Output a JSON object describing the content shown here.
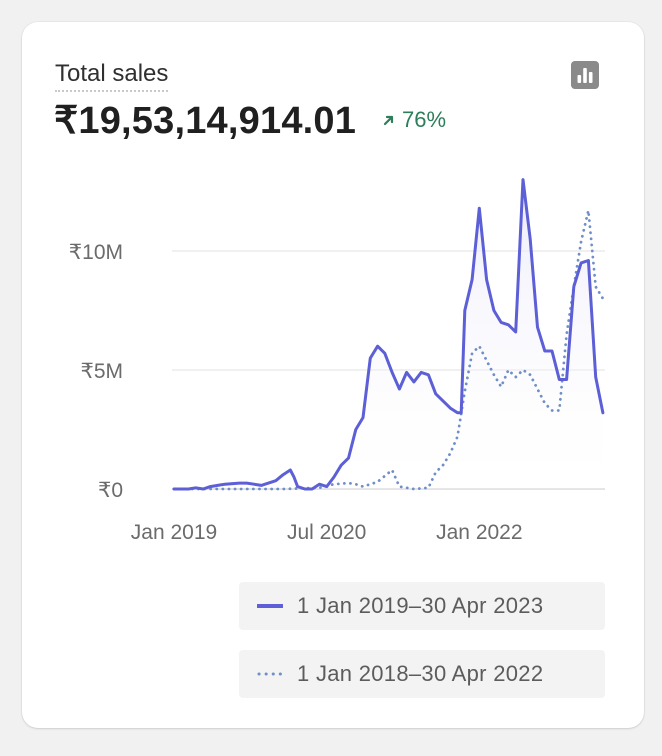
{
  "card": {
    "title": "Total sales",
    "total": "₹19,53,14,914.01",
    "change": "76%",
    "change_color": "#2e7d5b",
    "icon": "bar-chart-icon"
  },
  "chart_data": {
    "type": "line",
    "x_tick_labels": [
      "Jan 2019",
      "Jul 2020",
      "Jan 2022"
    ],
    "y_tick_labels": [
      "₹0",
      "₹5M",
      "₹10M"
    ],
    "ylim": [
      0,
      13000000
    ],
    "grid": true,
    "legend_position": "bottom",
    "series": [
      {
        "name": "1 Jan 2019–30 Apr 2023",
        "style": "solid",
        "color": "#5c5fd6",
        "points": [
          {
            "m": 0,
            "v": 0
          },
          {
            "m": 2,
            "v": 0
          },
          {
            "m": 3,
            "v": 50000
          },
          {
            "m": 4,
            "v": 0
          },
          {
            "m": 5,
            "v": 100000
          },
          {
            "m": 6,
            "v": 150000
          },
          {
            "m": 7,
            "v": 200000
          },
          {
            "m": 9,
            "v": 250000
          },
          {
            "m": 10,
            "v": 250000
          },
          {
            "m": 11,
            "v": 200000
          },
          {
            "m": 12,
            "v": 150000
          },
          {
            "m": 13,
            "v": 250000
          },
          {
            "m": 14,
            "v": 350000
          },
          {
            "m": 15,
            "v": 600000
          },
          {
            "m": 16,
            "v": 800000
          },
          {
            "m": 16.5,
            "v": 500000
          },
          {
            "m": 17,
            "v": 100000
          },
          {
            "m": 18,
            "v": 0
          },
          {
            "m": 19,
            "v": 0
          },
          {
            "m": 20,
            "v": 200000
          },
          {
            "m": 21,
            "v": 100000
          },
          {
            "m": 22,
            "v": 500000
          },
          {
            "m": 23,
            "v": 1000000
          },
          {
            "m": 24,
            "v": 1300000
          },
          {
            "m": 25,
            "v": 2500000
          },
          {
            "m": 26,
            "v": 3000000
          },
          {
            "m": 27,
            "v": 5500000
          },
          {
            "m": 28,
            "v": 6000000
          },
          {
            "m": 29,
            "v": 5700000
          },
          {
            "m": 30,
            "v": 4900000
          },
          {
            "m": 31,
            "v": 4200000
          },
          {
            "m": 32,
            "v": 4900000
          },
          {
            "m": 33,
            "v": 4500000
          },
          {
            "m": 34,
            "v": 4900000
          },
          {
            "m": 35,
            "v": 4800000
          },
          {
            "m": 36,
            "v": 4000000
          },
          {
            "m": 37,
            "v": 3700000
          },
          {
            "m": 38,
            "v": 3400000
          },
          {
            "m": 39,
            "v": 3200000
          },
          {
            "m": 39.5,
            "v": 3200000
          },
          {
            "m": 40,
            "v": 7500000
          },
          {
            "m": 41,
            "v": 8800000
          },
          {
            "m": 42,
            "v": 11800000
          },
          {
            "m": 43,
            "v": 8800000
          },
          {
            "m": 44,
            "v": 7500000
          },
          {
            "m": 45,
            "v": 7000000
          },
          {
            "m": 46,
            "v": 6900000
          },
          {
            "m": 47,
            "v": 6600000
          },
          {
            "m": 48,
            "v": 13000000
          },
          {
            "m": 49,
            "v": 10500000
          },
          {
            "m": 50,
            "v": 6800000
          },
          {
            "m": 51,
            "v": 5800000
          },
          {
            "m": 52,
            "v": 5800000
          },
          {
            "m": 53,
            "v": 4600000
          },
          {
            "m": 54,
            "v": 4600000
          },
          {
            "m": 55,
            "v": 8500000
          },
          {
            "m": 56,
            "v": 9500000
          },
          {
            "m": 57,
            "v": 9600000
          },
          {
            "m": 58,
            "v": 4700000
          },
          {
            "m": 59,
            "v": 3200000
          }
        ]
      },
      {
        "name": "1 Jan 2018–30 Apr 2022",
        "style": "dotted",
        "color": "#6f8fc6",
        "points": [
          {
            "m": 0,
            "v": 0
          },
          {
            "m": 5,
            "v": 0
          },
          {
            "m": 10,
            "v": 0
          },
          {
            "m": 15,
            "v": 0
          },
          {
            "m": 20,
            "v": 50000
          },
          {
            "m": 22,
            "v": 200000
          },
          {
            "m": 24,
            "v": 250000
          },
          {
            "m": 25,
            "v": 200000
          },
          {
            "m": 26,
            "v": 100000
          },
          {
            "m": 28,
            "v": 300000
          },
          {
            "m": 30,
            "v": 800000
          },
          {
            "m": 31,
            "v": 100000
          },
          {
            "m": 33,
            "v": 0
          },
          {
            "m": 35,
            "v": 50000
          },
          {
            "m": 36,
            "v": 700000
          },
          {
            "m": 37,
            "v": 1000000
          },
          {
            "m": 38,
            "v": 1500000
          },
          {
            "m": 39,
            "v": 2200000
          },
          {
            "m": 40,
            "v": 4100000
          },
          {
            "m": 41,
            "v": 5700000
          },
          {
            "m": 42,
            "v": 6000000
          },
          {
            "m": 43,
            "v": 5400000
          },
          {
            "m": 44,
            "v": 4800000
          },
          {
            "m": 45,
            "v": 4300000
          },
          {
            "m": 46,
            "v": 5000000
          },
          {
            "m": 47,
            "v": 4700000
          },
          {
            "m": 48,
            "v": 5000000
          },
          {
            "m": 49,
            "v": 4800000
          },
          {
            "m": 50,
            "v": 4200000
          },
          {
            "m": 51,
            "v": 3600000
          },
          {
            "m": 52,
            "v": 3300000
          },
          {
            "m": 53,
            "v": 3300000
          },
          {
            "m": 54,
            "v": 6500000
          },
          {
            "m": 55,
            "v": 8500000
          },
          {
            "m": 56,
            "v": 10400000
          },
          {
            "m": 57,
            "v": 11700000
          },
          {
            "m": 58,
            "v": 8500000
          },
          {
            "m": 59,
            "v": 8000000
          }
        ]
      }
    ]
  }
}
